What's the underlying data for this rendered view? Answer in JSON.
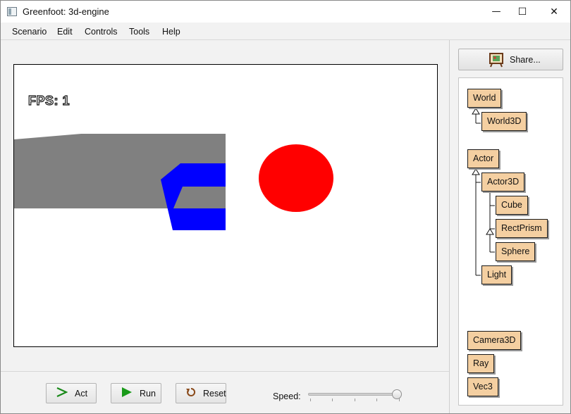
{
  "window": {
    "title": "Greenfoot: 3d-engine",
    "minimize_glyph": "—",
    "maximize_glyph": "☐",
    "close_glyph": "✕"
  },
  "menu": {
    "items": [
      "Scenario",
      "Edit",
      "Controls",
      "Tools",
      "Help"
    ]
  },
  "world": {
    "fps_label": "FPS: 1",
    "background_color": "#ffffff",
    "colors": {
      "gray_prism": "#808080",
      "blue_shape": "#0000ff",
      "sphere": "#ff0000"
    }
  },
  "controls": {
    "act_label": "Act",
    "run_label": "Run",
    "reset_label": "Reset",
    "speed_label": "Speed:",
    "speed_value_fraction": 0.97,
    "act_icon": "act-chevron-icon",
    "run_icon": "run-play-icon",
    "reset_icon": "reset-arrow-icon"
  },
  "share": {
    "label": "Share...",
    "icon": "share-easel-icon"
  },
  "classes": {
    "world": "World",
    "world3d": "World3D",
    "actor": "Actor",
    "actor3d": "Actor3D",
    "cube": "Cube",
    "rectprism": "RectPrism",
    "sphere": "Sphere",
    "light": "Light",
    "camera3d": "Camera3D",
    "ray": "Ray",
    "vec3": "Vec3",
    "fill_color": "#f4cfa1"
  }
}
